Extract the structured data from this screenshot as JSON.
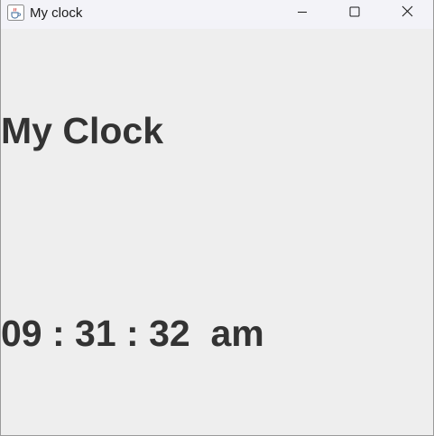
{
  "window": {
    "title": "My clock",
    "icon": "java-coffee-cup-icon"
  },
  "titlebar_buttons": {
    "minimize_icon": "minimize-icon",
    "maximize_icon": "maximize-icon",
    "close_icon": "close-icon"
  },
  "clock": {
    "heading": "My Clock",
    "time": "09 : 31 : 32  am"
  },
  "colors": {
    "text": "#333333",
    "background": "#eeeeee",
    "titlebar": "#f3f3f8"
  }
}
